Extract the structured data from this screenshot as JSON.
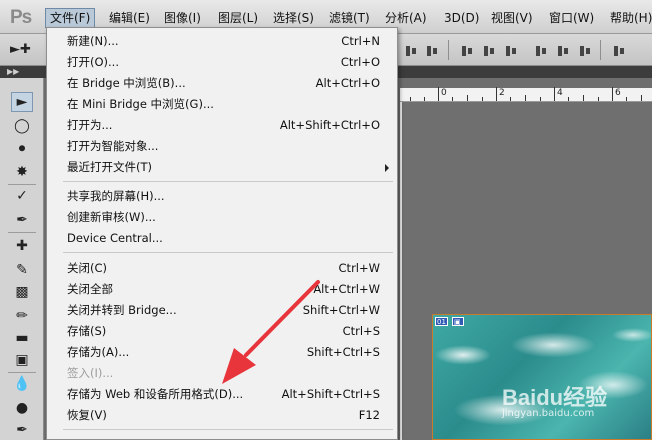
{
  "app": {
    "logo": "Ps"
  },
  "menubar": {
    "items": [
      {
        "id": "file",
        "label": "文件(F)"
      },
      {
        "id": "edit",
        "label": "编辑(E)"
      },
      {
        "id": "image",
        "label": "图像(I)"
      },
      {
        "id": "layer",
        "label": "图层(L)"
      },
      {
        "id": "select",
        "label": "选择(S)"
      },
      {
        "id": "filter",
        "label": "滤镜(T)"
      },
      {
        "id": "analysis",
        "label": "分析(A)"
      },
      {
        "id": "3d",
        "label": "3D(D)"
      },
      {
        "id": "view",
        "label": "视图(V)"
      },
      {
        "id": "window",
        "label": "窗口(W)"
      },
      {
        "id": "help",
        "label": "帮助(H)"
      }
    ]
  },
  "file_menu": {
    "items": [
      {
        "label": "新建(N)...",
        "shortcut": "Ctrl+N"
      },
      {
        "label": "打开(O)...",
        "shortcut": "Ctrl+O"
      },
      {
        "label": "在 Bridge 中浏览(B)...",
        "shortcut": "Alt+Ctrl+O"
      },
      {
        "label": "在 Mini Bridge 中浏览(G)...",
        "shortcut": ""
      },
      {
        "label": "打开为...",
        "shortcut": "Alt+Shift+Ctrl+O"
      },
      {
        "label": "打开为智能对象...",
        "shortcut": ""
      },
      {
        "label": "最近打开文件(T)",
        "shortcut": ""
      },
      {
        "label": "共享我的屏幕(H)...",
        "shortcut": ""
      },
      {
        "label": "创建新审核(W)...",
        "shortcut": ""
      },
      {
        "label": "Device Central...",
        "shortcut": ""
      },
      {
        "label": "关闭(C)",
        "shortcut": "Ctrl+W"
      },
      {
        "label": "关闭全部",
        "shortcut": "Alt+Ctrl+W"
      },
      {
        "label": "关闭并转到 Bridge...",
        "shortcut": "Shift+Ctrl+W"
      },
      {
        "label": "存储(S)",
        "shortcut": "Ctrl+S"
      },
      {
        "label": "存储为(A)...",
        "shortcut": "Shift+Ctrl+S"
      },
      {
        "label": "签入(I)...",
        "shortcut": ""
      },
      {
        "label": "存储为 Web 和设备所用格式(D)...",
        "shortcut": "Alt+Shift+Ctrl+S"
      },
      {
        "label": "恢复(V)",
        "shortcut": "F12"
      }
    ]
  },
  "ruler": {
    "labels": [
      "0",
      "2",
      "4",
      "6"
    ]
  },
  "canvas": {
    "slice_number": "01"
  },
  "watermark": {
    "text": "Baidu经验",
    "sub": "jingyan.baidu.com"
  },
  "colors": {
    "menu_highlight": "#b9c9d8",
    "annotation_arrow": "#e8343b",
    "canvas_border": "#c87b2a"
  }
}
